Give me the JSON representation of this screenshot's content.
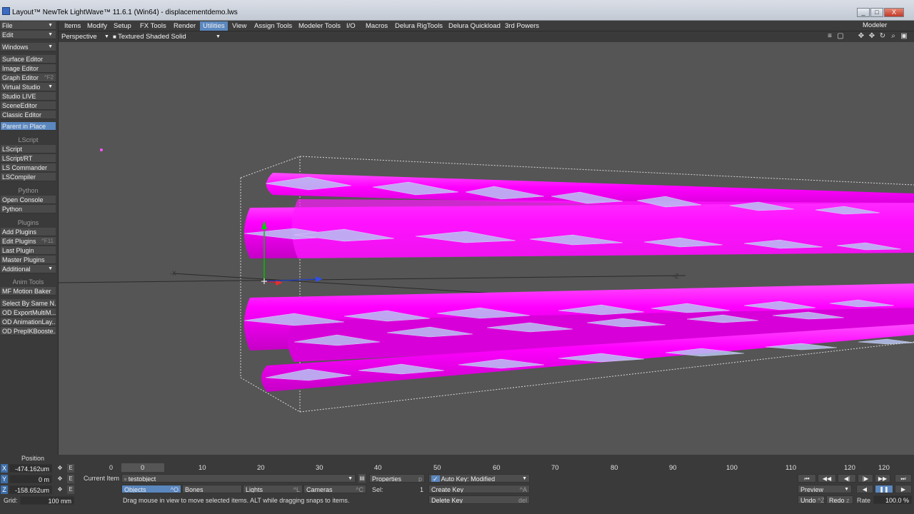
{
  "window": {
    "title": "Layout™ NewTek LightWave™ 11.6.1 (Win64) - displacementdemo.lws",
    "buttons": [
      "_",
      "□",
      "X"
    ]
  },
  "menubar": {
    "left_menus": [
      "File",
      "Edit"
    ],
    "tabs": [
      "Items",
      "Modify",
      "Setup",
      "FX Tools",
      "Render",
      "Utilities",
      "View",
      "Assign Tools",
      "Modeler Tools",
      "I/O",
      "Macros",
      "Delura RigTools",
      "Delura Quickload",
      "3rd Powers"
    ],
    "active_tab": "Utilities",
    "modeler_button": "Modeler"
  },
  "viewbar": {
    "view_mode": "Perspective",
    "shading_mode": "Textured Shaded Solid"
  },
  "sidebar": {
    "windows": "Windows",
    "group1": [
      "Surface Editor",
      "Image Editor",
      "Graph Editor",
      "Virtual Studio",
      "Studio LIVE",
      "SceneEditor",
      "Classic Editor"
    ],
    "graph_shortcut": "^F2",
    "parent_in_place": "Parent in Place",
    "lscript_head": "LScript",
    "lscript": [
      "LScript",
      "LScript/RT",
      "LS Commander",
      "LSCompiler"
    ],
    "python_head": "Python",
    "python": [
      "Open Console",
      "Python"
    ],
    "plugins_head": "Plugins",
    "plugins": [
      "Add Plugins",
      "Edit Plugins",
      "Last Plugin",
      "Master Plugins",
      "Additional"
    ],
    "edit_plugins_shortcut": "^F11",
    "anim_head": "Anim Tools",
    "anim": [
      "MF Motion Baker"
    ],
    "extra": [
      "Select By Same N...",
      "OD ExportMultiM...",
      "OD AnimationLay...",
      "OD PrepIKBooste..."
    ]
  },
  "viewport": {
    "axis_labels": [
      "-X",
      "-Z",
      "Z"
    ]
  },
  "bottom": {
    "position_label": "Position",
    "x_axis": "X",
    "y_axis": "Y",
    "z_axis": "Z",
    "x_value": "-474.162um",
    "y_value": "0 m",
    "z_value": "-158.652um",
    "grid_label": "Grid:",
    "grid_value": "100 mm",
    "e_label": "E",
    "current_frame": "0",
    "timeline_ticks": [
      "0",
      "10",
      "20",
      "30",
      "40",
      "50",
      "60",
      "70",
      "80",
      "90",
      "100",
      "110",
      "120"
    ],
    "end_frame": "120",
    "current_item_label": "Current Item",
    "current_item": "testobject",
    "objects_btn": "Objects",
    "objects_key": "^O",
    "bones_btn": "Bones",
    "lights_btn": "Lights",
    "lights_key": "^L",
    "cameras_btn": "Cameras",
    "cameras_key": "^C",
    "properties_btn": "Properties",
    "properties_key": "p",
    "sel_label": "Sel:",
    "sel_value": "1",
    "autokey": "Auto Key: Modified",
    "create_key": "Create Key",
    "create_key_sc": "^A",
    "delete_key": "Delete Key",
    "delete_key_sc": "del",
    "status": "Drag mouse in view to move selected items. ALT while dragging snaps to items.",
    "preview": "Preview",
    "undo": "Undo",
    "undo_sc": "^Z",
    "redo": "Redo",
    "redo_sc": "z",
    "rate_label": "Rate",
    "rate_value": "100.0 %"
  },
  "colors": {
    "accent": "#5b87bf",
    "viewport_bg": "#555555",
    "object_magenta": "#ff00ff",
    "wire_blue": "#a7b9f0"
  }
}
